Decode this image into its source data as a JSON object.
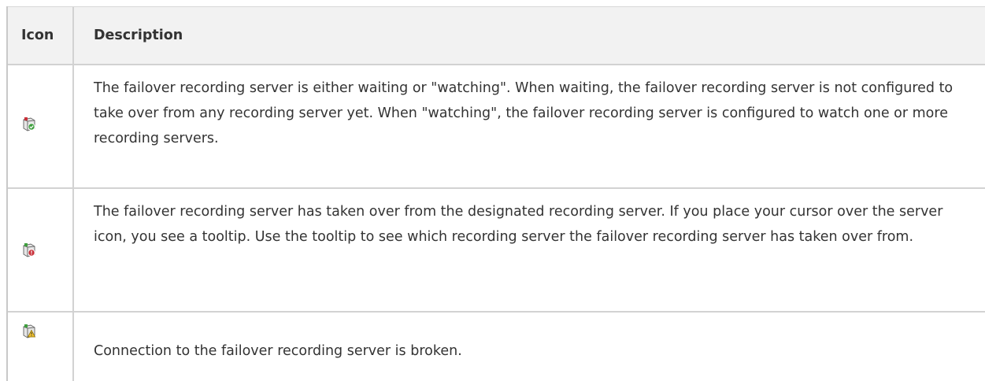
{
  "table": {
    "headers": {
      "icon": "Icon",
      "description": "Description"
    },
    "rows": [
      {
        "icon": "failover-watching-icon",
        "description": "The failover recording server is either waiting or \"watching\". When waiting, the failover recording server is not configured to take over from any recording server yet. When \"watching\", the failover recording server is configured to watch one or more recording servers."
      },
      {
        "icon": "failover-taken-over-icon",
        "description": "The failover recording server has taken over from the designated recording server. If you place your cursor over the server icon, you see a tooltip. Use the tooltip to see which recording server the failover recording server has taken over from."
      },
      {
        "icon": "failover-connection-broken-icon",
        "description": "Connection to the failover recording server is broken."
      }
    ]
  },
  "colors": {
    "header_bg": "#f2f2f2",
    "border": "#d2d2d2",
    "text": "#333333",
    "badge_green": "#3f9f3f",
    "badge_red": "#c8313a",
    "badge_yellow": "#f1c232"
  }
}
